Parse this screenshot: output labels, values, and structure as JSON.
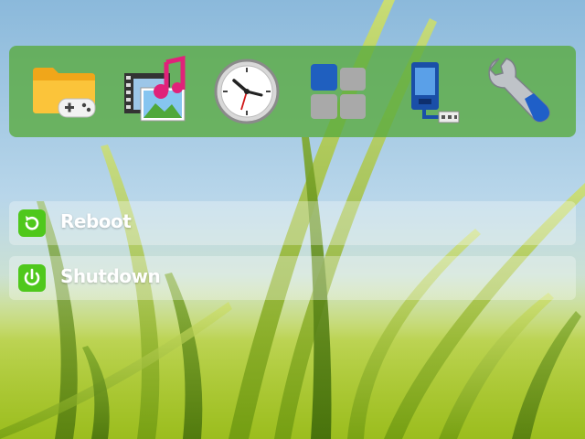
{
  "dock": {
    "apps": [
      {
        "icon": "games-folder-icon"
      },
      {
        "icon": "media-icon"
      },
      {
        "icon": "clock-icon"
      },
      {
        "icon": "tiles-icon"
      },
      {
        "icon": "phone-usb-icon"
      },
      {
        "icon": "wrench-settings-icon"
      }
    ]
  },
  "menu": {
    "reboot": {
      "label": "Reboot",
      "icon": "reboot-icon"
    },
    "shutdown": {
      "label": "Shutdown",
      "icon": "power-icon"
    }
  },
  "colors": {
    "dock_bg": "#58aa3c",
    "button_green": "#4fc81c"
  }
}
